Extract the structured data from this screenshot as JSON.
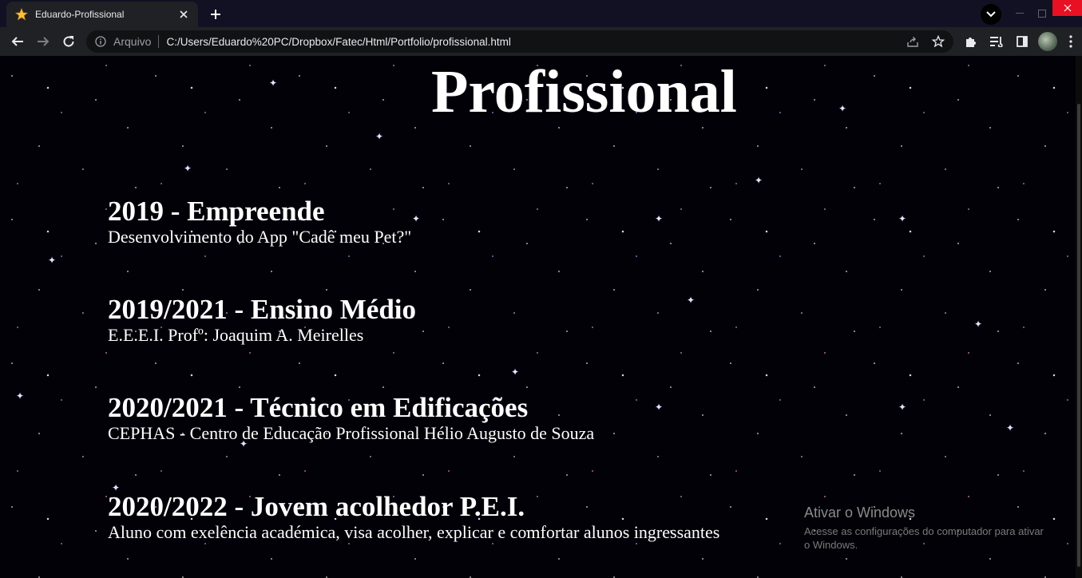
{
  "browser": {
    "tab_title": "Eduardo-Profissional",
    "omnibox": {
      "scheme_label": "Arquivo",
      "url": "C:/Users/Eduardo%20PC/Dropbox/Fatec/Html/Portfolio/profissional.html"
    }
  },
  "page": {
    "title": "Profissional",
    "entries": [
      {
        "heading": "2019 - Empreende",
        "description": "Desenvolvimento do App \"Cadê meu Pet?\""
      },
      {
        "heading": "2019/2021 - Ensino Médio",
        "description": "E.E.E.I. Profº: Joaquim A. Meirelles"
      },
      {
        "heading": "2020/2021 - Técnico em Edificações",
        "description": "CEPHAS - Centro de Educação Profissional Hélio Augusto de Souza"
      },
      {
        "heading": "2020/2022 - Jovem acolhedor P.E.I.",
        "description": "Aluno com exelência académica, visa acolher, explicar e comfortar alunos ingressantes"
      }
    ]
  },
  "activation_watermark": {
    "title": "Ativar o Windows",
    "text": "Acesse as configurações do computador para ativar o Windows."
  },
  "colors": {
    "tabbar": "#111123",
    "toolbar": "#202124",
    "close_button": "#e81123",
    "page_text": "#ffffff"
  }
}
